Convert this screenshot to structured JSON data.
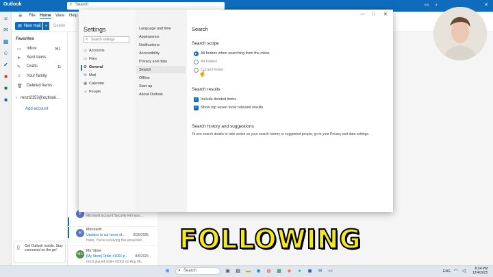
{
  "app": {
    "title": "Outlook",
    "search_placeholder": "Search"
  },
  "ribbon": {
    "tabs": [
      "File",
      "Home",
      "View",
      "Help"
    ],
    "new_mail": "New mail",
    "delete": "Delete"
  },
  "folders": {
    "favorites": "Favorites",
    "items": [
      {
        "label": "Inbox",
        "count": "941"
      },
      {
        "label": "Sent Items",
        "count": ""
      },
      {
        "label": "Drafts",
        "count": "11"
      },
      {
        "label": "Your family",
        "count": ""
      },
      {
        "label": "Deleted Items",
        "count": ""
      }
    ],
    "account": "renzt2153@outlook...",
    "add_account": "Add account"
  },
  "messages": [
    {
      "sender": "Microsoft account securit...",
      "subject": "",
      "preview": "Microsoft account Security info was ...",
      "date": "8/2/2025",
      "avatar": "M",
      "color": "#5b73c9"
    },
    {
      "sender": "Microsoft",
      "subject": "Updates to our terms of...",
      "preview": "Hello, You're receiving this email bec...",
      "date": "8/30/2025",
      "avatar": "M",
      "color": "#5b73c9"
    },
    {
      "sender": "My Store",
      "subject": "[My Store] Order #1001 p...",
      "preview": "renzt placed order #1001 on Aug 06...",
      "date": "8/6/2025",
      "avatar": "MS",
      "color": "#4f8f4a"
    }
  ],
  "promo": {
    "text": "Get Outlook mobile. Stay connected on the go!"
  },
  "settings": {
    "title": "Settings",
    "search_placeholder": "Search settings",
    "nav": [
      {
        "label": "Accounts",
        "icon": "person-icon"
      },
      {
        "label": "Files",
        "icon": "file-icon"
      },
      {
        "label": "General",
        "icon": "gear-icon"
      },
      {
        "label": "Mail",
        "icon": "mail-icon"
      },
      {
        "label": "Calendar",
        "icon": "calendar-icon"
      },
      {
        "label": "People",
        "icon": "people-icon"
      }
    ],
    "subnav": [
      "Language and time",
      "Appearance",
      "Notifications",
      "Accessibility",
      "Privacy and data",
      "Search",
      "Offline",
      "Start up",
      "About Outlook"
    ],
    "page_title": "Search",
    "scope_title": "Search scope",
    "scope_options": [
      "All folders when searching from the inbox",
      "All folders",
      "Current folder"
    ],
    "results_title": "Search results",
    "results_options": [
      "Include deleted items",
      "Show top seven most relevant results"
    ],
    "history_title": "Search history and suggestions",
    "history_text": "To see search details or take action on your search history or suggested people, go to your Privacy and data settings."
  },
  "caption": "FOLLOWING",
  "taskbar": {
    "search": "Search",
    "lang": "ENG",
    "time": "8:34 PM",
    "date": "12/4/2025"
  }
}
